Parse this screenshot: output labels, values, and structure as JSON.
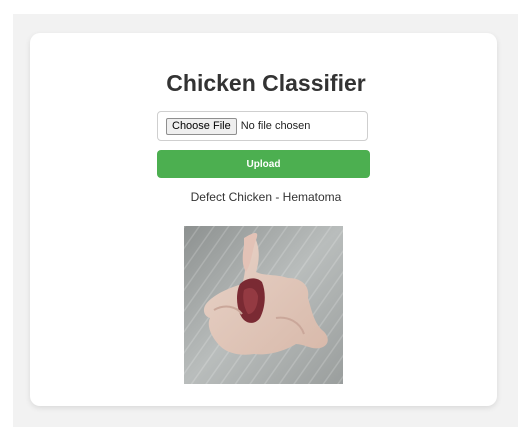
{
  "app": {
    "title": "Chicken Classifier"
  },
  "upload_form": {
    "choose_file_label": "Choose File",
    "file_status": "No file chosen",
    "upload_label": "Upload"
  },
  "result": {
    "text": "Defect Chicken - Hematoma"
  },
  "image": {
    "description_icon": "chicken-photo"
  },
  "colors": {
    "upload_button": "#4caf50",
    "background": "#f2f2f2",
    "card": "#ffffff",
    "title_text": "#333333"
  }
}
